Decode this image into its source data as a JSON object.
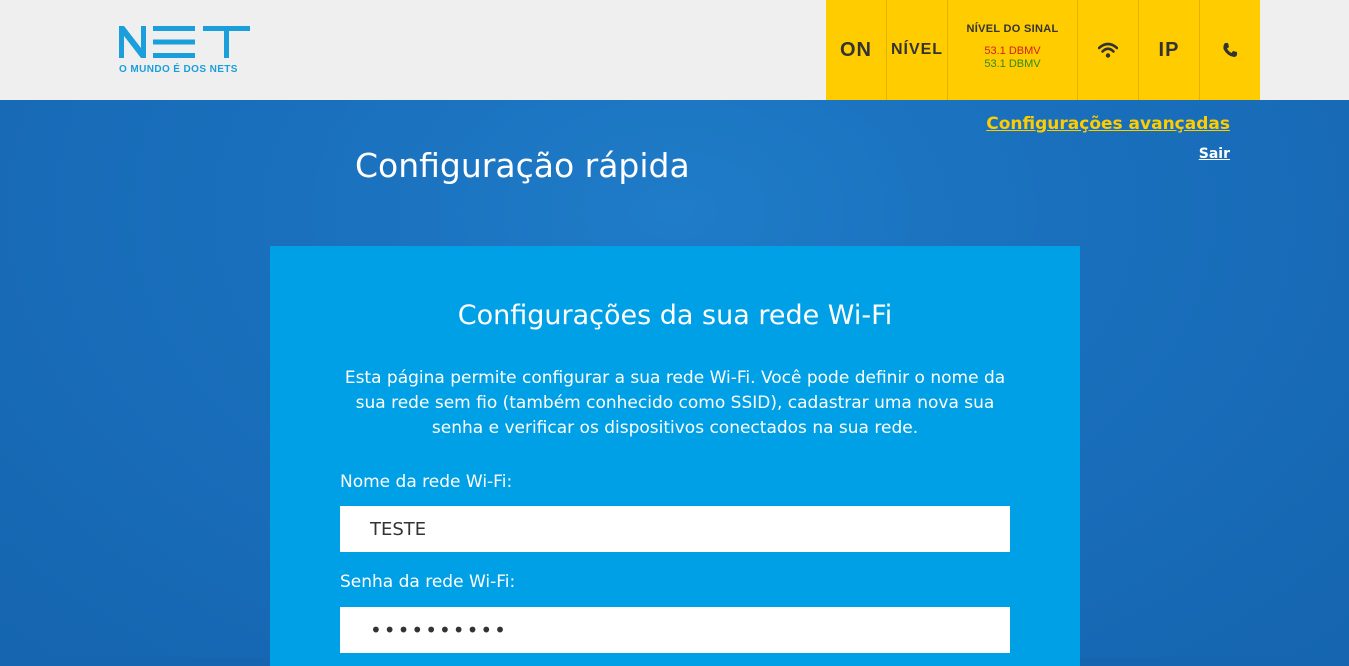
{
  "logo": {
    "word": "NET",
    "tagline": "O MUNDO É DOS NETS",
    "color": "#1a9fdc"
  },
  "status": {
    "on_label": "ON",
    "nivel_label": "NÍVEL",
    "signal_title": "NÍVEL DO SINAL",
    "signal_value_1": "53.1 DBMV",
    "signal_value_2": "53.1 DBMV",
    "signal_value_1_color": "#d0201c",
    "signal_value_2_color": "#2e8b1e",
    "wifi_icon": "wifi-icon",
    "ip_label": "IP",
    "phone_icon": "phone-icon",
    "strip_color": "#ffcc00"
  },
  "header": {
    "title": "Configuração rápida",
    "advanced_link": "Configurações avançadas",
    "logout_link": "Sair"
  },
  "card": {
    "title": "Configurações da sua rede Wi-Fi",
    "description": "Esta página permite configurar a sua rede Wi-Fi. Você pode definir o nome da sua rede sem fio (também conhecido como SSID), cadastrar uma nova sua senha e verificar os dispositivos conectados na sua rede.",
    "ssid_label": "Nome da rede Wi-Fi:",
    "ssid_value": "TESTE",
    "password_label": "Senha da rede Wi-Fi:",
    "password_value": "••••••••••"
  },
  "colors": {
    "background": "#1565b0",
    "card": "#00a0e6",
    "accent": "#ffcc00"
  }
}
